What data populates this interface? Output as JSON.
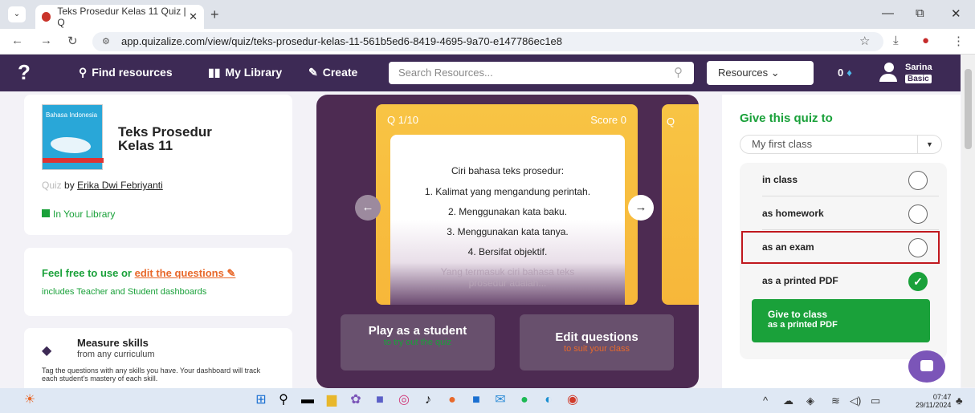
{
  "browser": {
    "tab_title": "Teks Prosedur Kelas 11 Quiz | Q",
    "url": "app.quizalize.com/view/quiz/teks-prosedur-kelas-11-561b5ed6-8419-4695-9a70-e147786ec1e8"
  },
  "nav": {
    "find": "Find resources",
    "library": "My Library",
    "create": "Create",
    "search_placeholder": "Search Resources...",
    "resources": "Resources",
    "score": "0",
    "user_name": "Sarina",
    "user_badge": "Basic"
  },
  "quiz_info": {
    "cover_text": "Bahasa Indonesia",
    "title": "Teks Prosedur Kelas 11",
    "type_label": "Quiz",
    "by": "by",
    "author": "Erika Dwi Febriyanti",
    "library_status": "In Your Library"
  },
  "usage": {
    "free_text": "Feel free to use or",
    "edit_link": "edit the questions",
    "includes": "includes Teacher and Student dashboards"
  },
  "skills": {
    "title": "Measure skills",
    "subtitle": "from any curriculum",
    "description": "Tag the questions with any skills you have. Your dashboard will track each student's mastery of each skill."
  },
  "question": {
    "number": "Q 1/10",
    "score": "Score 0",
    "next_card_label": "Q",
    "lines": [
      "Ciri bahasa teks prosedur:",
      "1. Kalimat yang mengandung perintah.",
      "2. Menggunakan kata baku.",
      "3. Menggunakan kata tanya.",
      "4. Bersifat objektif.",
      "Yang termasuk ciri bahasa teks",
      "prosedur adalah..."
    ]
  },
  "actions": {
    "play_main": "Play as a student",
    "play_sub": "to try out the quiz",
    "edit_main": "Edit questions",
    "edit_sub": "to suit your class"
  },
  "give": {
    "title": "Give this quiz to",
    "class": "My first class",
    "options": [
      "in class",
      "as homework",
      "as an exam",
      "as a printed PDF"
    ],
    "selected": "as a printed PDF",
    "button_line1": "Give to class",
    "button_line2": "as a printed PDF"
  },
  "taskbar": {
    "time": "07:47",
    "date": "29/11/2024"
  },
  "colors": {
    "brand_purple": "#3d2a55",
    "accent_green": "#1aa13a",
    "accent_orange": "#e8692b",
    "highlight_red": "#c0181e"
  }
}
